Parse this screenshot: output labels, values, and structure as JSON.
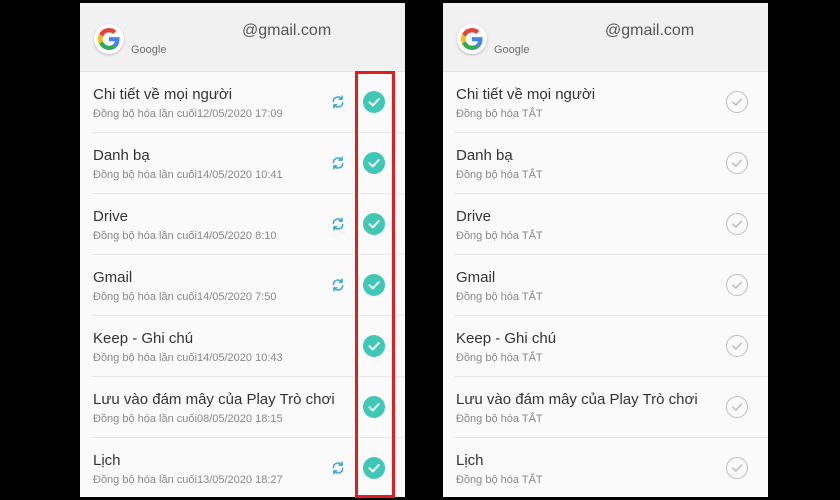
{
  "colors": {
    "accent": "#3fc8b5",
    "sync": "#38a6d8",
    "highlight": "#e11d1d",
    "unchecked": "#bdbdbd"
  },
  "left_panel": {
    "header": {
      "brand": "Google",
      "email": "@gmail.com",
      "icon": "google-logo"
    },
    "items": [
      {
        "title": "Chi tiết về mọi người",
        "subtitle": "Đồng bộ hóa lần cuối12/05/2020 17:09",
        "sync_icon": true,
        "checked": true
      },
      {
        "title": "Danh bạ",
        "subtitle": "Đồng bộ hóa lần cuối14/05/2020 10:41",
        "sync_icon": true,
        "checked": true
      },
      {
        "title": "Drive",
        "subtitle": "Đồng bộ hóa lần cuối14/05/2020 8:10",
        "sync_icon": true,
        "checked": true
      },
      {
        "title": "Gmail",
        "subtitle": "Đồng bộ hóa lần cuối14/05/2020 7:50",
        "sync_icon": true,
        "checked": true
      },
      {
        "title": "Keep - Ghi chú",
        "subtitle": "Đồng bộ hóa lần cuối14/05/2020 10:43",
        "sync_icon": false,
        "checked": true
      },
      {
        "title": "Lưu vào đám mây của Play Trò chơi",
        "subtitle": "Đồng bộ hóa lần cuối08/05/2020 18:15",
        "sync_icon": false,
        "checked": true
      },
      {
        "title": "Lịch",
        "subtitle": "Đồng bộ hóa lần cuối13/05/2020 18:27",
        "sync_icon": true,
        "checked": true
      }
    ]
  },
  "right_panel": {
    "header": {
      "brand": "Google",
      "email": "@gmail.com",
      "icon": "google-logo"
    },
    "items": [
      {
        "title": "Chi tiết về mọi người",
        "subtitle": "Đồng bộ hóa TẮT",
        "checked": false
      },
      {
        "title": "Danh bạ",
        "subtitle": "Đồng bộ hóa TẮT",
        "checked": false
      },
      {
        "title": "Drive",
        "subtitle": "Đồng bộ hóa TẮT",
        "checked": false
      },
      {
        "title": "Gmail",
        "subtitle": "Đồng bộ hóa TẮT",
        "checked": false
      },
      {
        "title": "Keep - Ghi chú",
        "subtitle": "Đồng bộ hóa TẮT",
        "checked": false
      },
      {
        "title": "Lưu vào đám mây của Play Trò chơi",
        "subtitle": "Đồng bộ hóa TẮT",
        "checked": false
      },
      {
        "title": "Lịch",
        "subtitle": "Đồng bộ hóa TẮT",
        "checked": false
      }
    ]
  }
}
